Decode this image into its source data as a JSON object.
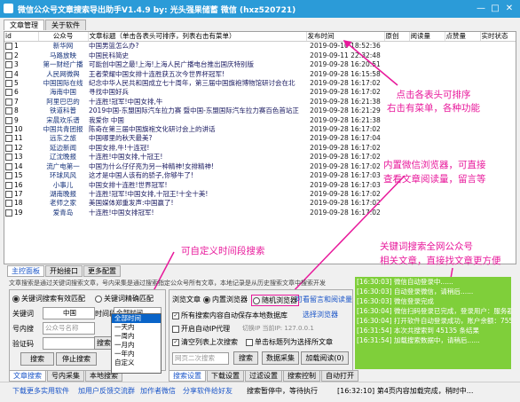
{
  "window": {
    "title": "微信公众号文章搜索导出助手V1.4.9    by:  光头强果储蓄 微信  (hxz520721)",
    "min": "—",
    "max": "□",
    "close": "✕"
  },
  "top_tabs": [
    "文章管理",
    "关于软件"
  ],
  "table": {
    "columns": [
      "id",
      "公众号",
      "文章标题（单击各表头可排序，列表右击有菜单）",
      "发布时间",
      "原创",
      "阅读量",
      "点赞量",
      "实时状态"
    ],
    "rows": [
      {
        "id": "1",
        "account": "新华网",
        "title": "中国男篮怎么办?",
        "time": "2019-09-10 18:52:36"
      },
      {
        "id": "2",
        "account": "马路放映",
        "title": "中国民科简史",
        "time": "2019-09-11 22:32:48"
      },
      {
        "id": "3",
        "account": "第一财经广播",
        "title": "可能创中国之最!上海!上海人民广播电台推出国庆特别版",
        "time": "2019-09-28 16:20:51"
      },
      {
        "id": "4",
        "account": "人民网微舆",
        "title": "王者荣耀中国女排十连胜获五次今世界杯冠军!",
        "time": "2019-09-28 16:15:58"
      },
      {
        "id": "5",
        "account": "中国国际在线",
        "title": "纪念中华人民共和国成立七十周年，第三届中国旗袍博物馆研讨会在北",
        "time": "2019-09-28 16:17:02"
      },
      {
        "id": "6",
        "account": "海南中国",
        "title": "寻找中国好兵",
        "time": "2019-09-28 16:17:02"
      },
      {
        "id": "7",
        "account": "阿里巴巴的",
        "title": "十连胜!冠军!中国女排,牛",
        "time": "2019-09-28 16:21:38"
      },
      {
        "id": "8",
        "account": "铁道科普",
        "title": "2019中国-东盟国际汽车拉力赛 暨中国-东盟国际汽车拉力赛百色首站正",
        "time": "2019-09-28 16:21:29"
      },
      {
        "id": "9",
        "account": "宋晨欢乐谱",
        "title": "我爱你 中国",
        "time": "2019-09-28 16:21:38"
      },
      {
        "id": "10",
        "account": "中国共青团报",
        "title": "陈奇在第三届中国旗袍文化研讨会上的讲话",
        "time": "2019-09-28 16:17:02"
      },
      {
        "id": "11",
        "account": "远东之旅",
        "title": "中国哪里的秋天最美?",
        "time": "2019-09-28 16:17:04"
      },
      {
        "id": "12",
        "account": "延边新闻",
        "title": "中国女排,牛!十连冠!",
        "time": "2019-09-28 16:17:02"
      },
      {
        "id": "13",
        "account": "辽沈晚报",
        "title": "十连胜!中国女排,十冠王!",
        "time": "2019-09-28 16:17:02"
      },
      {
        "id": "14",
        "account": "流广电第一",
        "title": "中国为什么仔仔亮为另一种精神!女排精神!",
        "time": "2019-09-28 16:17:02"
      },
      {
        "id": "15",
        "account": "环球风风",
        "title": "这才是中国人该有的骄子,你够牛了!",
        "time": "2019-09-28 16:17:03"
      },
      {
        "id": "16",
        "account": "小事儿",
        "title": "中国女排十连胜!世界冠军!",
        "time": "2019-09-28 16:17:03"
      },
      {
        "id": "17",
        "account": "湖南晚报",
        "title": "十连胜!冠军!中国女排,十冠王!十全十美!",
        "time": "2019-09-28 16:17:02"
      },
      {
        "id": "18",
        "account": "老师之家",
        "title": "美国媒体郑重发声:中国赢了!",
        "time": "2019-09-28 16:17:02"
      },
      {
        "id": "19",
        "account": "爱青岛",
        "title": "十连胜!中国女排冠军!",
        "time": "2019-09-28 16:17:02"
      }
    ]
  },
  "annotations": {
    "sort": "点击各表头可排序\n右击有菜单，各种功能",
    "browser": "内置微信浏览器，可直接\n查看文章阅读量，留言等",
    "time_range": "可自定义时间段搜索",
    "keyword": "关键词搜索全网公众号\n相关文章，直接找文章更方便"
  },
  "bottom_tabs": [
    "主控面板",
    "开始接口",
    "更多配置"
  ],
  "search_panel": {
    "hint": "文章搜索是通过关键词搜索文章，号内采集是通过搜索指定公众号所有文章，本地记录是从历史搜索文章中搜索开发",
    "radio_keyword": "关键词搜索有效匹配",
    "radio_date": "关键词精确匹配",
    "keyword_label": "关键词",
    "keyword_value": "中国",
    "time_label": "时间段",
    "time_value": "全部时间",
    "account_label": "号内搜",
    "account_placeholder": "公众号名称",
    "captcha_label": "验证码",
    "search_button": "搜索",
    "stop_button": "停止搜索",
    "exit_button": "搜索中",
    "time_options": [
      "全部时间",
      "一天内",
      "一周内",
      "一月内",
      "一年内",
      "自定义"
    ]
  },
  "left_bottom_tabs": [
    "文章搜索",
    "号内采集",
    "本地搜索"
  ],
  "browser_panel": {
    "group_label": "浏览文章",
    "radio_internal": "内置浏览器",
    "radio_default": "随机浏览器",
    "read_count_note": "可看留言和阅读量",
    "choose_browser": "选择浏览器",
    "chk_auto_save": "所有搜索内容自动保存本地数据库",
    "chk_auto_proxy": "开启自动IP代理",
    "proxy_note": "切换IP 当前IP: 127.0.0.1",
    "chk_filter": "清空列表上次搜索",
    "chk_single": "单击标题列为选择所文章",
    "btn_repeat_import": "网页二次搜索",
    "btn_search": "搜索",
    "btn_collect": "数据采集",
    "btn_load": "加载阅读(0)"
  },
  "right_tabs": [
    "搜索设置",
    "下载设置",
    "过滤设置",
    "搜索控制",
    "自动打开"
  ],
  "log": [
    "[16:30:03] 微信自动登录中......",
    "[16:30:03] 自动登录微信，请稍后......",
    "[16:30:03] 微信登录完成",
    "[16:30:04] 微信扫码登录已完成，登录用户：服务器中",
    "[16:30:04] 打开软件自动登录成功，账户余额：7558",
    "[16:31:54] 本次共搜索到 45135 条结果",
    "[16:31:54] 加载搜索数据中，请稍后......"
  ],
  "status": {
    "items": [
      "下载更多实用软件",
      "加用户反馈交流群",
      "加作者微信",
      "分享软件给好友",
      "搜索暂停中，等待执行",
      "[16:32:10] 第4页内容加载完成，稍时中..."
    ]
  }
}
